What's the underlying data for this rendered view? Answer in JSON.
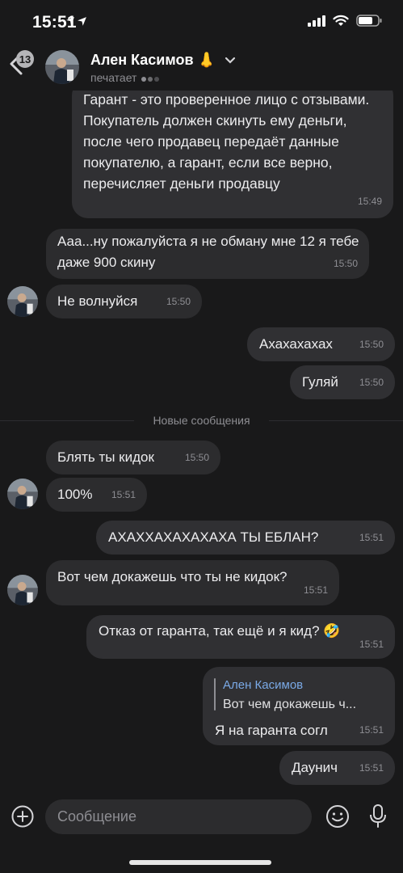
{
  "status_bar": {
    "time": "15:51"
  },
  "header": {
    "back_count": "13",
    "contact_name": "Ален Касимов 👃",
    "status_text": "печатает"
  },
  "messages": [
    {
      "text": "Гарант - это проверенное лицо с отзывами. Покупатель должен скинуть ему деньги, после чего продавец передаёт данные покупателю, а гарант, если все верно, перечисляет деньги продавцу",
      "time": "15:49"
    },
    {
      "text": "Ааа...ну пожалуйста я не обману мне 12 я тебе даже 900 скину",
      "time": "15:50"
    },
    {
      "text": "Не волнуйся",
      "time": "15:50"
    },
    {
      "text": "Ахахахахах",
      "time": "15:50"
    },
    {
      "text": "Гуляй",
      "time": "15:50"
    },
    {
      "text": "Блять ты кидок",
      "time": "15:50"
    },
    {
      "text": "100%",
      "time": "15:51"
    },
    {
      "text": "АХАХХАХАХАХАХА ТЫ ЕБЛАН?",
      "time": "15:51"
    },
    {
      "text": "Вот чем докажешь что ты не кидок?",
      "time": "15:51"
    },
    {
      "text": "Отказ от гаранта, так ещё и я кид? 🤣",
      "time": "15:51"
    },
    {
      "text": "Я на гаранта согл",
      "time": "15:51",
      "reply_author": "Ален Касимов",
      "reply_text": "Вот чем докажешь ч..."
    },
    {
      "text": "Даунич",
      "time": "15:51"
    }
  ],
  "divider": "Новые сообщения",
  "composer": {
    "placeholder": "Сообщение"
  },
  "colors": {
    "background": "#19191a",
    "bubble": "#2c2c2e",
    "accent": "#7aa9e6"
  }
}
